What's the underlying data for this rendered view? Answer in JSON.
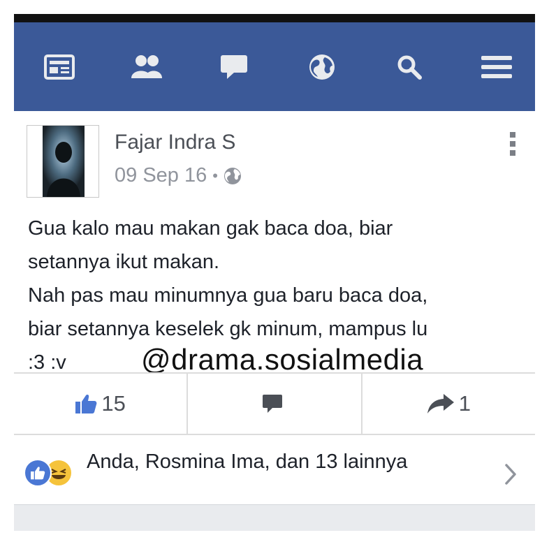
{
  "colors": {
    "navbar": "#3b5998",
    "nav_icon": "#e9ebee",
    "like_blue": "#4a77d4",
    "text_dark": "#1d2129",
    "text_meta": "#90949c"
  },
  "navbar": {
    "items": [
      {
        "icon": "news-feed-icon"
      },
      {
        "icon": "friends-icon"
      },
      {
        "icon": "messages-icon"
      },
      {
        "icon": "notifications-globe-icon"
      },
      {
        "icon": "search-icon"
      },
      {
        "icon": "menu-icon"
      }
    ]
  },
  "post": {
    "author": "Fajar Indra S",
    "date": "09 Sep 16",
    "dot": "•",
    "privacy_icon": "globe-icon",
    "text": "Gua kalo mau makan gak baca doa, biar\nsetannya ikut makan.\nNah pas mau minumnya gua baru baca doa,\nbiar setannya keselek gk minum, mampus lu\n:3 :v",
    "watermark": "@drama.sosialmedia"
  },
  "actions": {
    "like_count": "15",
    "comment_count": "",
    "share_count": "1"
  },
  "reactions": {
    "summary": "Anda, Rosmina Ima, dan 13 lainnya",
    "icons": [
      "like-reaction-icon",
      "haha-reaction-icon"
    ]
  }
}
